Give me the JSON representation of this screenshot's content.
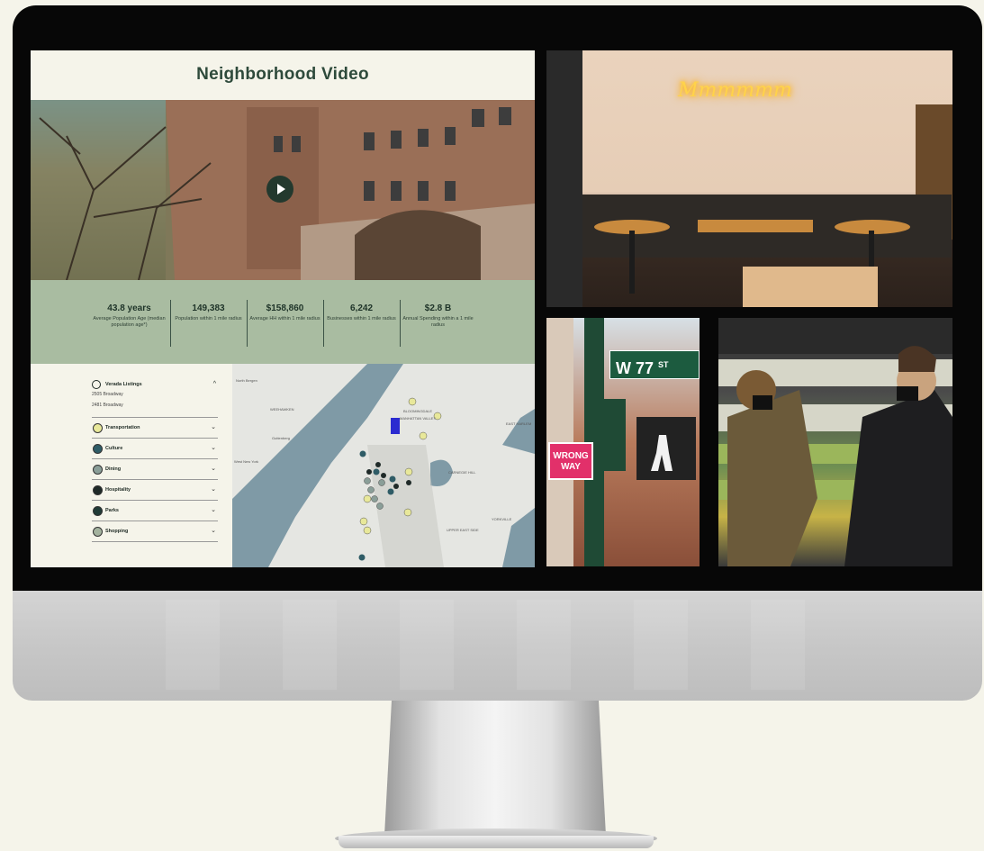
{
  "page": {
    "title": "Neighborhood Video"
  },
  "stats": [
    {
      "value": "43.8 years",
      "label": "Average Population Age (median population age*)"
    },
    {
      "value": "149,383",
      "label": "Population within 1 mile radius"
    },
    {
      "value": "$158,860",
      "label": "Average HH within 1 mile radius"
    },
    {
      "value": "6,242",
      "label": "Businesses within 1 mile radius"
    },
    {
      "value": "$2.8 B",
      "label": "Annual Spending within a 1 mile radius"
    }
  ],
  "filters": {
    "header": "Verada Listings",
    "addresses": [
      "2505 Broadway",
      "2481 Broadway"
    ],
    "items": [
      {
        "label": "Transportation",
        "color": "#e8e89a"
      },
      {
        "label": "Culture",
        "color": "#2f5c66"
      },
      {
        "label": "Dining",
        "color": "#8a9e98"
      },
      {
        "label": "Hospitality",
        "color": "#1f2a28"
      },
      {
        "label": "Parks",
        "color": "#213b37"
      },
      {
        "label": "Shopping",
        "color": "#a3b29e"
      }
    ]
  },
  "map": {
    "labels": [
      "North Bergen",
      "Guttenberg",
      "West New York",
      "WEEHAWKEN",
      "MANHATTAN VALLEY",
      "EAST HARLEM",
      "CARNEGIE HILL",
      "YORKVILLE",
      "UPPER EAST SIDE",
      "BLOOMINGDALE"
    ]
  },
  "photos": {
    "neon_text": "Mmmmmm",
    "street_sign": "W 77",
    "street_sign_suffix": "ST",
    "wrong_way": "WRONG WAY"
  }
}
